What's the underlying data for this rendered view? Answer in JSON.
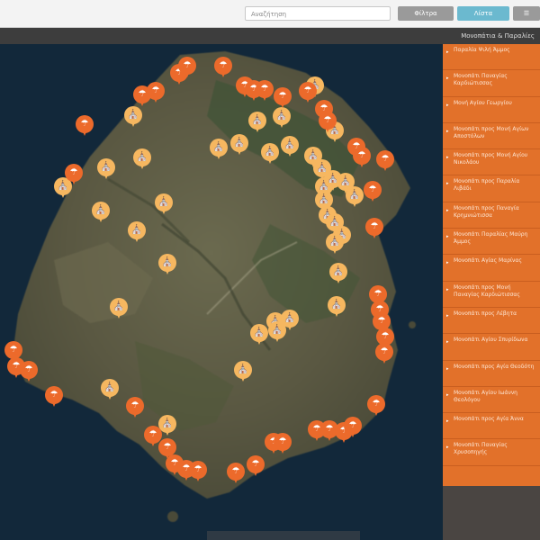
{
  "header": {
    "search_placeholder": "Αναζήτηση",
    "buttons": [
      "Φίλτρα",
      "Λίστα",
      "☰"
    ]
  },
  "subbar": {
    "title": "Μονοπάτια & Παραλίες"
  },
  "sidebar": {
    "items": [
      "Παραλία Ψιλή Άμμος",
      "Μονοπάτι Παναγίας Καρδιώτισσας",
      "Μονή Αγίου Γεωργίου",
      "Μονοπάτι προς Μονή Αγίων Αποστόλων",
      "Μονοπάτι προς Μονή Αγίου Νικολάου",
      "Μονοπάτι προς Παραλία Λιβάδι",
      "Μονοπάτι προς Παναγία Κρημνιώτισσα",
      "Μονοπάτι Παραλίας Μαύρη Άμμος",
      "Μονοπάτι Αγίας Μαρίνας",
      "Μονοπάτι προς Μονή Παναγίας Καρδιώτισσας",
      "Μονοπάτι προς Λέβητα",
      "Μονοπάτι Αγίου Σπυρίδωνα",
      "Μονοπάτι προς Αγία Θεοδότη",
      "Μονοπάτι Αγίου Ιωάννη Θεολόγου",
      "Μονοπάτι προς Αγία Άννα",
      "Μονοπάτι Παναγίας Χρυσοπηγής"
    ]
  },
  "map": {
    "icons": {
      "monastery": "monastery-icon",
      "beach": "beach-umbrella-icon"
    },
    "colors": {
      "monastery": "#f6b760",
      "beach": "#ec6a2b",
      "sea": "#12283a",
      "land": "#5b5a45"
    }
  }
}
